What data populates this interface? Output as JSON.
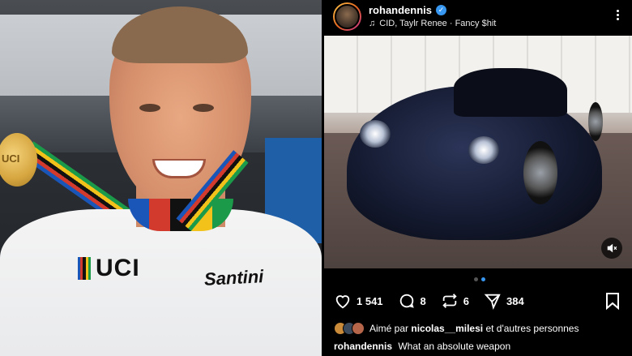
{
  "left_photo": {
    "medal_text": "UCI",
    "jersey_logo": "UCI",
    "sponsor": "Santini"
  },
  "post": {
    "header": {
      "username": "rohandennis",
      "verified_icon": "verified-check-icon",
      "music": "CID, Taylr Renee · Fancy $hit",
      "more_icon": "more-vertical-icon"
    },
    "media": {
      "mute_icon": "speaker-muted-icon",
      "carousel_count": 2,
      "carousel_active_index": 1
    },
    "actions": {
      "likes": "1 541",
      "comments": "8",
      "reposts": "6",
      "shares": "384"
    },
    "liked_by": {
      "prefix": "Aimé par",
      "user": "nicolas__milesi",
      "suffix": "et d'autres personnes"
    },
    "caption": {
      "username": "rohandennis",
      "text": "What an absolute weapon"
    },
    "colors": {
      "accent": "#3897f0",
      "background": "#000000"
    }
  }
}
